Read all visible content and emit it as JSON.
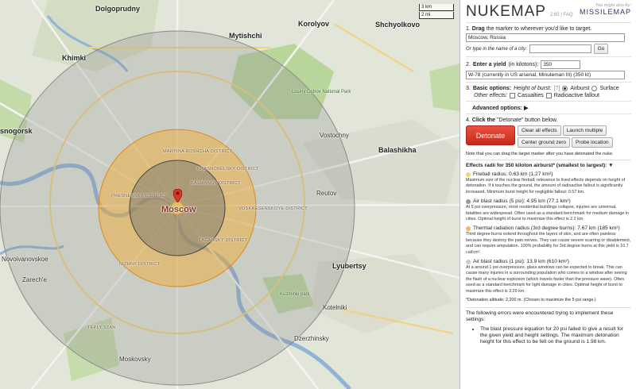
{
  "map": {
    "scale": [
      "3 km",
      "2 mi"
    ],
    "labels": {
      "dolgoprudny": "Dolgoprudny",
      "khimki": "Khimki",
      "mytishchi": "Mytishchi",
      "korolyov": "Korolyov",
      "shchyolkovo": "Shchyolkovo",
      "krasnogorsk": "snogorsk",
      "balashikha": "Balashikha",
      "reutov": "Reutov",
      "vostochny": "Vostochny",
      "moscow": "Moscow",
      "novoivankovskoe": "Novoivanovskoe",
      "zarech": "Zarech'e",
      "lyubertsy": "Lyubertsy",
      "kotelniki": "Kotelniki",
      "dzerzhinsky": "Dzerzhinsky",
      "moskovsky": "Moskovsky",
      "losiny": "Losiny Ostrov National Park",
      "kuzminki": "Kuzminki park",
      "district1": "MARYINA ROSHCHA DISTRICT",
      "district2": "BASMANNY DISTRICT",
      "district3": "KRASNOSELSKY DISTRICT",
      "district4": "PRESNENSKY DISTRICT",
      "district5": "TAGANSKY DISTRICT",
      "district6": "NIZHNY DISTRICT",
      "district7": "TEPLY STAN",
      "district8": "VOSKRESENSKOYE DISTRICT"
    }
  },
  "panel": {
    "logo": "NUKEMAP",
    "version": "2.65",
    "faq": "FAQ",
    "might_also_like": "You might also try:",
    "missilemap": "MISSILEMAP",
    "step1": {
      "num": "1.",
      "title": "Drag",
      "rest": "the marker to wherever you'd like to target.",
      "location_value": "Moscow, Russia",
      "or_type": "Or type in the name of a city:",
      "city_placeholder": "",
      "go": "Go"
    },
    "step2": {
      "num": "2.",
      "title": "Enter a yield",
      "unit": "(in kilotons):",
      "yield_value": "350",
      "preset": "W-78 (currently in US arsenal, Minuteman III) (350 kt)"
    },
    "step3": {
      "num": "3.",
      "title": "Basic options:",
      "hob": "Height of burst:",
      "hob_help": "[?]",
      "airburst": "Airburst",
      "surface": "Surface",
      "other": "Other effects:",
      "casualties": "Casualties",
      "fallout": "Radioactive fallout"
    },
    "advanced": "Advanced options: ▶",
    "step4": {
      "num": "4.",
      "click": "Click the",
      "quote": "\"Detonate\"",
      "rest": "button below.",
      "detonate": "Detonate",
      "clear": "Clear all effects",
      "launch": "Launch multiple",
      "center": "Center ground zero",
      "probe": "Probe location"
    },
    "note": "Note that you can drag the target marker after you have detonated the nuke.",
    "effects_title": "Effects radii for 350 kiloton airburst* (smallest to largest): ▼",
    "effects": [
      {
        "color": "#f3d77d",
        "head": "Fireball radius: 0.63 km (1.27 km²)",
        "body": "Maximum size of the nuclear fireball; relevance to lived effects depends on height of detonation. If it touches the ground, the amount of radioactive fallout is significantly increased. Minimum burst height for negligible fallout: 0.57 km."
      },
      {
        "color": "#9a9a9a",
        "head": "Air blast radius (5 psi): 4.95 km (77.1 km²)",
        "body": "At 5 psi overpressure, most residential buildings collapse, injuries are universal, fatalities are widespread. Often used as a standard benchmark for medium damage in cities. Optimal height of burst to maximize this effect is 2.2 km."
      },
      {
        "color": "#f2b860",
        "head": "Thermal radiation radius (3rd degree burns): 7.67 km (185 km²)",
        "body": "Third degree burns extend throughout the layers of skin, and are often painless because they destroy the pain nerves. They can cause severe scarring or disablement, and can require amputation. 100% probability for 3rd degree burns at this yield is 10.7 cal/cm²."
      },
      {
        "color": "#c9c9c9",
        "head": "Air blast radius (1 psi): 13.9 km (610 km²)",
        "body": "At a around 1 psi overpressure, glass windows can be expected to break. This can cause many injuries in a surrounding population who comes to a window after seeing the flash of a nuclear explosion (which travels faster than the pressure wave). Often used as a standard benchmark for light damage in cities. Optimal height of burst to maximize this effect is 3.29 km."
      }
    ],
    "detonation_alt": "*Detonation altitude: 2,200 m. (Chosen to maximize the 5 psi range.)",
    "errors_intro": "The following errors were encountered trying to implement these settings:",
    "errors": [
      "The blast pressure equation for 20 psi failed to give a result for the given yield and height settings. The maximum detonation height for this effect to be felt on the ground is 1.98 km."
    ]
  }
}
